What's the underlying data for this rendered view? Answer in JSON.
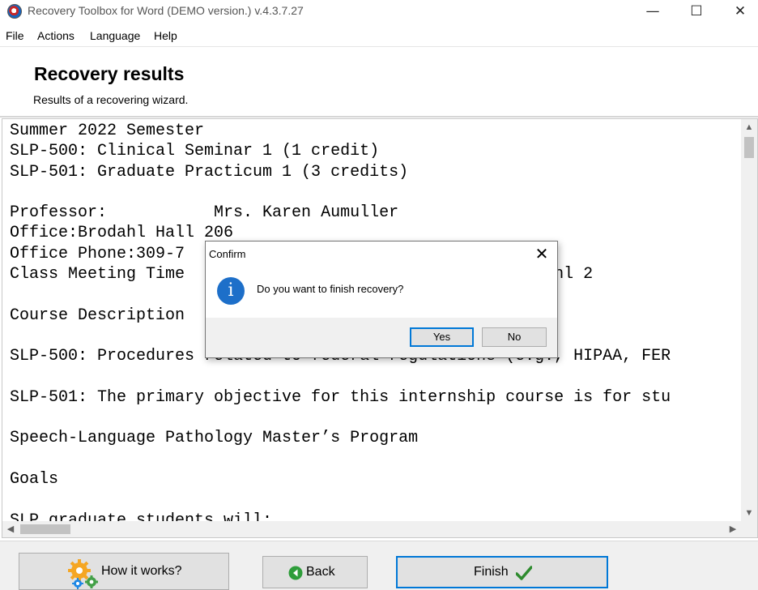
{
  "window": {
    "title": "Recovery Toolbox for Word (DEMO version.) v.4.3.7.27",
    "minimize_glyph": "—",
    "maximize_glyph": "☐",
    "close_glyph": "✕"
  },
  "menu": {
    "items": [
      "File",
      "Actions",
      "Language",
      "Help"
    ]
  },
  "header": {
    "title": "Recovery results",
    "subtitle": "Results of a recovering wizard."
  },
  "document": {
    "lines": [
      "Summer 2022 Semester",
      "SLP-500: Clinical Seminar 1 (1 credit)",
      "SLP-501: Graduate Practicum 1 (3 credits)",
      "",
      "Professor:           Mrs. Karen Aumuller",
      "Office:Brodahl Hall 206",
      "Office Phone:309-7",
      "Class Meeting Time                         5 am in Brodahl 2",
      "",
      "Course Description",
      "",
      "SLP-500: Procedures related to federal regulations (e.g., HIPAA, FER",
      "",
      "SLP-501: The primary objective for this internship course is for stu",
      "",
      "Speech-Language Pathology Master’s Program",
      "",
      "Goals",
      "",
      "SLP graduate students will:"
    ],
    "scroll_up_glyph": "▲",
    "scroll_down_glyph": "▼",
    "scroll_left_glyph": "◀",
    "scroll_right_glyph": "▶"
  },
  "buttons": {
    "how_label": "How it works?",
    "back_label": "Back",
    "finish_label": "Finish"
  },
  "dialog": {
    "title": "Confirm",
    "close_glyph": "✕",
    "icon_glyph": "i",
    "message": "Do you want to finish recovery?",
    "yes_label": "Yes",
    "no_label": "No"
  },
  "colors": {
    "accent": "#0078d7",
    "info_icon": "#1d6fc9",
    "gear_orange": "#f5a623",
    "gear_blue": "#1e88e5",
    "gear_green": "#43a047",
    "back_green": "#2e9d3a",
    "check_green": "#2e8b2e"
  },
  "icons": [
    "app-icon",
    "gear-icon",
    "back-arrow-icon",
    "check-icon",
    "info-icon",
    "close-icon"
  ]
}
